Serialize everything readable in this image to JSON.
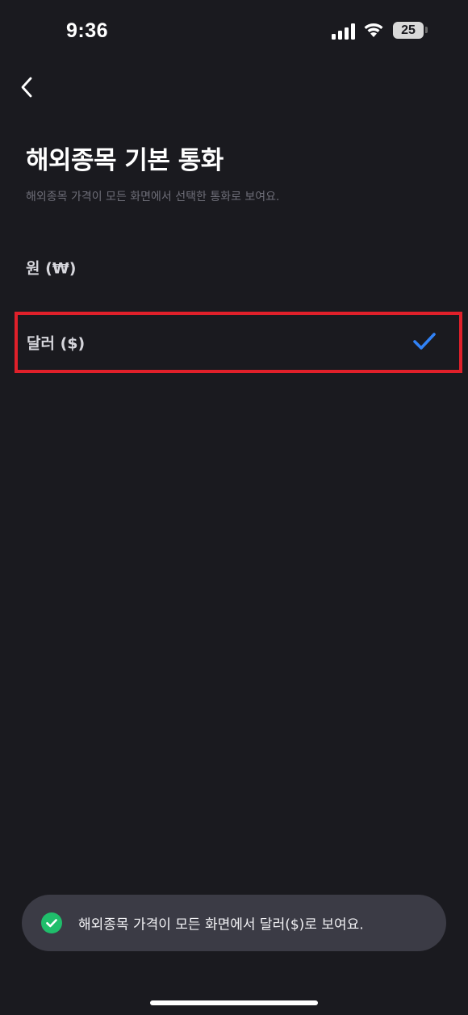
{
  "status_bar": {
    "time": "9:36",
    "battery_level": "25",
    "icons": [
      "signal-icon",
      "wifi-icon",
      "battery-icon"
    ]
  },
  "nav": {
    "back_icon": "chevron-left-icon"
  },
  "page": {
    "title": "해외종목 기본 통화",
    "subtitle": "해외종목 가격이 모든 화면에서 선택한 통화로 보여요."
  },
  "options": [
    {
      "label": "원 (₩)",
      "selected": false
    },
    {
      "label": "달러 ($)",
      "selected": true
    }
  ],
  "toast": {
    "icon": "check-circle-icon",
    "message": "해외종목 가격이 모든 화면에서 달러($)로 보여요."
  },
  "colors": {
    "background": "#1a1a1f",
    "accent_check": "#3182f6",
    "toast_success": "#1fbe6b",
    "highlight_box": "#e0202a"
  }
}
